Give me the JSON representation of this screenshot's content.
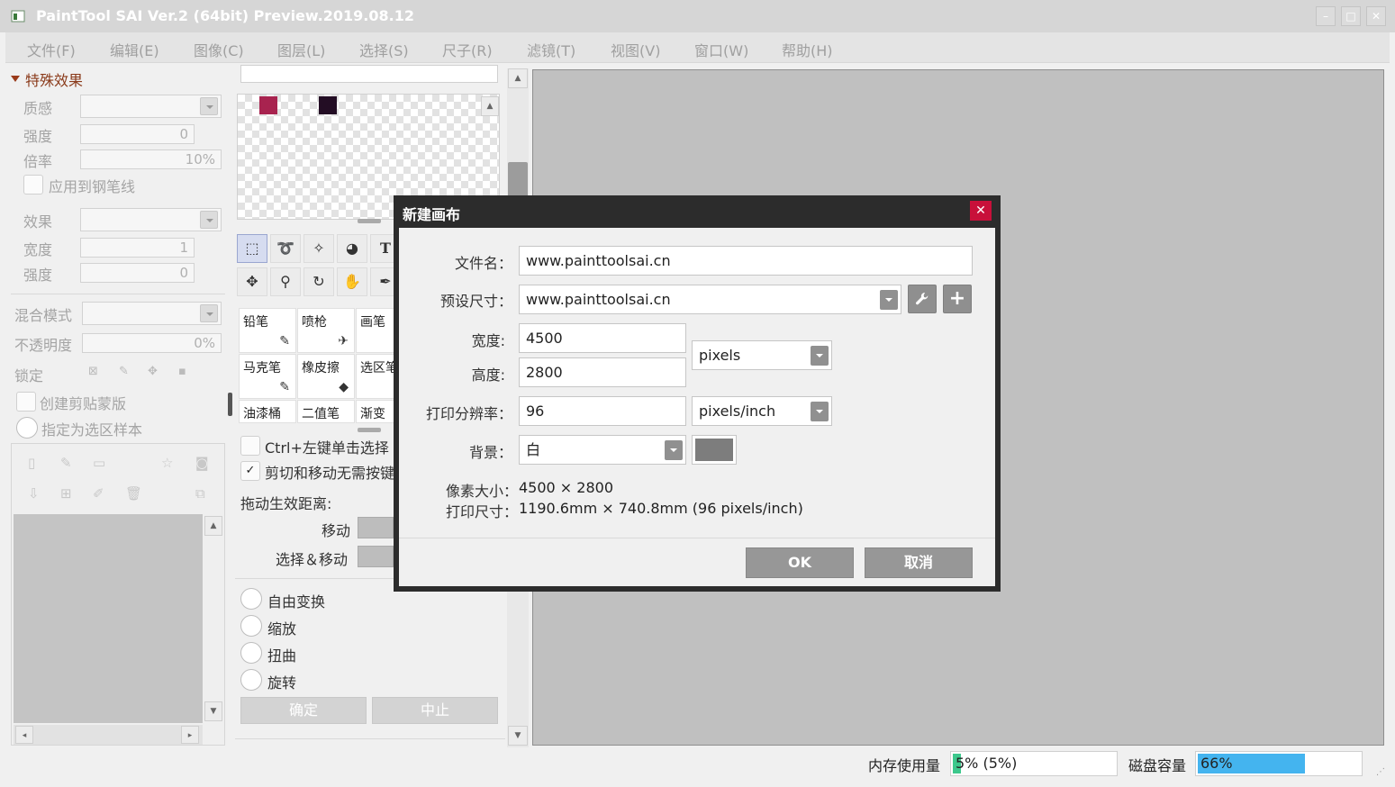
{
  "titlebar": {
    "title": "PaintTool SAI Ver.2 (64bit) Preview.2019.08.12",
    "min": "–",
    "max": "□",
    "close": "✕"
  },
  "menu": [
    "文件(F)",
    "编辑(E)",
    "图像(C)",
    "图层(L)",
    "选择(S)",
    "尺子(R)",
    "滤镜(T)",
    "视图(V)",
    "窗口(W)",
    "帮助(H)"
  ],
  "effects": {
    "header": "特殊效果",
    "texture_label": "质感",
    "strength_label": "强度",
    "strength_value": "0",
    "scale_label": "倍率",
    "scale_value": "10%",
    "apply_pen": "应用到钢笔线",
    "effect_label": "效果",
    "width_label": "宽度",
    "width_value": "1",
    "strength2_label": "强度",
    "strength2_value": "0"
  },
  "layer": {
    "blend_label": "混合模式",
    "opacity_label": "不透明度",
    "opacity_value": "0%",
    "lock_label": "锁定",
    "clipping": "创建剪贴蒙版",
    "selection_source": "指定为选区样本"
  },
  "toolbox": {
    "text_tool": "T"
  },
  "brushes": [
    {
      "name": "铅笔",
      "icon": "✎"
    },
    {
      "name": "喷枪",
      "icon": "✈"
    },
    {
      "name": "画笔",
      "icon": ""
    },
    {
      "name": "马克笔",
      "icon": "✎"
    },
    {
      "name": "橡皮擦",
      "icon": "◆"
    },
    {
      "name": "选区笔",
      "icon": ""
    },
    {
      "name": "油漆桶",
      "icon": ""
    },
    {
      "name": "二值笔",
      "icon": ""
    },
    {
      "name": "渐变",
      "icon": ""
    }
  ],
  "transform": {
    "ctrl_click": "Ctrl+左键单击选择",
    "cut_move": "剪切和移动无需按键",
    "drag_distance": "拖动生效距离:",
    "move_label": "移动",
    "select_move_label": "选择＆移动",
    "free_transform": "自由变换",
    "scale": "缩放",
    "distort": "扭曲",
    "rotate": "旋转",
    "ok": "确定",
    "abort": "中止"
  },
  "palette": {
    "colors": [
      "#a8234f",
      "#230d24"
    ]
  },
  "dialog": {
    "title": "新建画布",
    "close": "✕",
    "filename_label": "文件名：",
    "filename_value": "www.painttoolsai.cn",
    "preset_label": "预设尺寸：",
    "preset_value": "www.painttoolsai.cn",
    "width_label": "宽度:",
    "width_value": "4500",
    "height_label": "高度:",
    "height_value": "2800",
    "unit_value": "pixels",
    "dpi_label": "打印分辨率：",
    "dpi_value": "96",
    "dpi_unit_value": "pixels/inch",
    "bg_label": "背景：",
    "bg_value": "白",
    "pixel_size_label": "像素大小：",
    "pixel_size_value": "4500 × 2800",
    "print_size_label": "打印尺寸：",
    "print_size_value": "1190.6mm × 740.8mm (96 pixels/inch)",
    "ok": "OK",
    "cancel": "取消",
    "wrench_icon": "wrench-icon",
    "plus_icon": "plus-icon"
  },
  "status": {
    "memory_label": "内存使用量",
    "memory_value": "5% (5%)",
    "memory_fraction": 0.05,
    "disk_label": "磁盘容量",
    "disk_value": "66%",
    "disk_fraction": 0.66
  }
}
